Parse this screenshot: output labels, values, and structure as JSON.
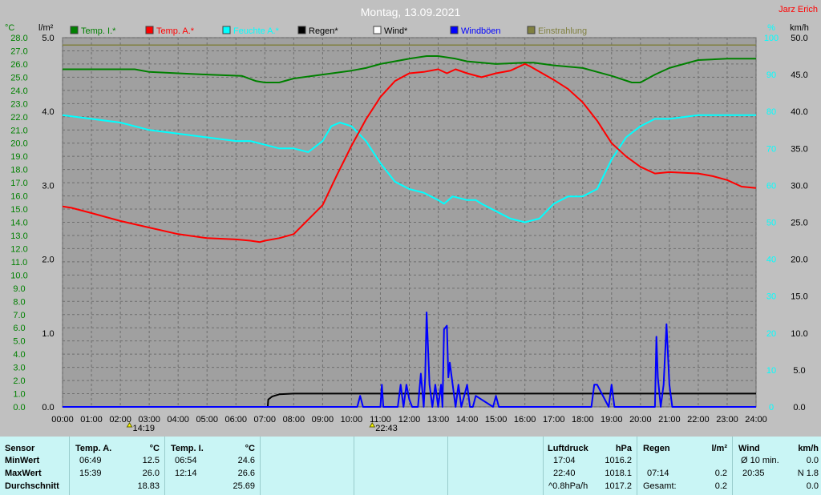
{
  "header": {
    "title": "Montag, 13.09.2021",
    "author": "Jarz Erich",
    "unit_left_temp": "°C",
    "unit_left_rain": "l/m²",
    "unit_right_pct": "%",
    "unit_right_kmh": "km/h"
  },
  "legend": [
    {
      "label": "Temp. I.*",
      "color": "#008000"
    },
    {
      "label": "Temp. A.*",
      "color": "#ff0000"
    },
    {
      "label": "Feuchte A.*",
      "color": "#00ffff"
    },
    {
      "label": "Regen*",
      "color": "#000000"
    },
    {
      "label": "Wind*",
      "color": "#ffffff"
    },
    {
      "label": "Windböen",
      "color": "#0000ff"
    },
    {
      "label": "Einstrahlung",
      "color": "#808040"
    }
  ],
  "markers": {
    "sunrise": "14:19",
    "sunset": "22:43"
  },
  "chart_data": {
    "type": "line",
    "x_unit": "time of day",
    "x_ticks": [
      "00:00",
      "01:00",
      "02:00",
      "03:00",
      "04:00",
      "05:00",
      "06:00",
      "07:00",
      "08:00",
      "09:00",
      "10:00",
      "11:00",
      "12:00",
      "13:00",
      "14:00",
      "15:00",
      "16:00",
      "17:00",
      "18:00",
      "19:00",
      "20:00",
      "21:00",
      "22:00",
      "23:00",
      "24:00"
    ],
    "temp_axis_ticks": [
      "28.0",
      "27.0",
      "26.0",
      "25.0",
      "24.0",
      "23.0",
      "22.0",
      "21.0",
      "20.0",
      "19.0",
      "18.0",
      "17.0",
      "16.0",
      "15.0",
      "14.0",
      "13.0",
      "12.0",
      "11.0",
      "10.0",
      "9.0",
      "8.0",
      "7.0",
      "6.0",
      "5.0",
      "4.0",
      "3.0",
      "2.0",
      "1.0",
      "0.0"
    ],
    "rain_axis_ticks": [
      "5.0",
      "4.0",
      "3.0",
      "2.0",
      "1.0",
      "0.0"
    ],
    "pct_axis_ticks": [
      "100",
      "90",
      "80",
      "70",
      "60",
      "50",
      "40",
      "30",
      "20",
      "10",
      "0"
    ],
    "kmh_axis_ticks": [
      "50.0",
      "45.0",
      "40.0",
      "35.0",
      "30.0",
      "25.0",
      "20.0",
      "15.0",
      "10.0",
      "5.0",
      "0.0"
    ],
    "ylim_temp": [
      0,
      28
    ],
    "ylim_rain": [
      0,
      5
    ],
    "ylim_pct": [
      0,
      100
    ],
    "ylim_kmh": [
      0,
      50
    ],
    "series": [
      {
        "name": "Temp. I.*",
        "axis": "temp",
        "color": "#008000",
        "x": [
          0,
          1,
          2,
          2.5,
          3,
          4,
          5,
          6.2,
          6.7,
          7,
          7.5,
          8,
          9,
          10,
          10.5,
          11,
          12,
          12.6,
          13,
          13.6,
          14,
          15,
          16,
          16.3,
          17,
          18,
          18.5,
          19,
          19.7,
          20,
          20.5,
          21,
          21.5,
          22,
          23,
          24
        ],
        "y": [
          25.6,
          25.6,
          25.6,
          25.6,
          25.4,
          25.3,
          25.2,
          25.1,
          24.7,
          24.6,
          24.6,
          24.9,
          25.2,
          25.5,
          25.7,
          26.0,
          26.4,
          26.6,
          26.6,
          26.4,
          26.2,
          26.0,
          26.1,
          26.1,
          25.9,
          25.7,
          25.4,
          25.1,
          24.6,
          24.6,
          25.2,
          25.7,
          26.0,
          26.3,
          26.4,
          26.4
        ]
      },
      {
        "name": "Temp. A.*",
        "axis": "temp",
        "color": "#ff0000",
        "x": [
          0,
          0.3,
          1,
          2,
          3,
          4,
          5,
          6,
          6.5,
          6.83,
          7,
          7.5,
          8,
          8.5,
          9,
          9.5,
          10,
          10.5,
          11,
          11.5,
          12,
          12.5,
          13,
          13.3,
          13.6,
          14,
          14.5,
          15,
          15.5,
          16,
          16.2,
          17,
          17.5,
          18,
          18.5,
          19,
          19.5,
          20,
          20.5,
          21,
          22,
          22.5,
          23,
          23.5,
          24
        ],
        "y": [
          15.2,
          15.1,
          14.7,
          14.1,
          13.6,
          13.1,
          12.8,
          12.7,
          12.6,
          12.5,
          12.6,
          12.8,
          13.1,
          14.2,
          15.3,
          17.6,
          19.8,
          21.8,
          23.5,
          24.7,
          25.3,
          25.4,
          25.6,
          25.3,
          25.6,
          25.3,
          25.0,
          25.3,
          25.5,
          26.0,
          25.8,
          24.8,
          24.1,
          23.1,
          21.7,
          20.0,
          19.0,
          18.2,
          17.7,
          17.8,
          17.7,
          17.5,
          17.2,
          16.7,
          16.6
        ]
      },
      {
        "name": "Feuchte A.*",
        "axis": "pct",
        "color": "#00ffff",
        "x": [
          0,
          1,
          2,
          3,
          4,
          5,
          6,
          6.5,
          7,
          7.5,
          8,
          8.5,
          9,
          9.3,
          9.6,
          10,
          10.5,
          11,
          11.5,
          12,
          12.5,
          13,
          13.2,
          13.5,
          14,
          14.3,
          14.5,
          15,
          15.5,
          16,
          16.5,
          17,
          17.5,
          18,
          18.5,
          19,
          19.5,
          20,
          20.5,
          21,
          22,
          23,
          24
        ],
        "y": [
          79,
          78,
          77,
          75,
          74,
          73,
          72,
          72,
          71,
          70,
          70,
          69,
          72,
          76,
          77,
          76,
          72,
          66,
          61,
          59,
          58,
          56,
          55,
          57,
          56,
          56,
          55,
          53,
          51,
          50,
          51,
          55,
          57,
          57,
          59,
          67,
          73,
          76,
          78,
          78,
          79,
          79,
          79
        ]
      },
      {
        "name": "Regen*",
        "axis": "rain",
        "color": "#000000",
        "x": [
          0,
          7.1,
          7.12,
          7.25,
          7.5,
          8,
          24
        ],
        "y": [
          0,
          0,
          0.1,
          0.14,
          0.17,
          0.18,
          0.18
        ]
      },
      {
        "name": "Windböen",
        "axis": "kmh",
        "color": "#0000ff",
        "x": [
          0,
          10.2,
          10.3,
          10.4,
          11,
          11.05,
          11.1,
          11.6,
          11.7,
          11.8,
          11.9,
          12,
          12.1,
          12.3,
          12.4,
          12.5,
          12.55,
          12.6,
          12.7,
          12.8,
          12.9,
          13,
          13.1,
          13.15,
          13.2,
          13.3,
          13.35,
          13.4,
          13.5,
          13.6,
          13.7,
          13.8,
          13.9,
          14,
          14.1,
          14.2,
          14.3,
          14.9,
          15,
          15.1,
          18.3,
          18.4,
          18.5,
          18.9,
          19,
          19.1,
          20.5,
          20.55,
          20.6,
          20.7,
          20.8,
          20.9,
          21,
          21.1,
          21.2,
          24
        ],
        "y": [
          0,
          0,
          1.5,
          0,
          0,
          3,
          0,
          0,
          3,
          0,
          3,
          1,
          0,
          0,
          4.5,
          0,
          4,
          12.8,
          3,
          0,
          3,
          0,
          3,
          0,
          10.5,
          11,
          4,
          6,
          3,
          0,
          3,
          0,
          1.5,
          3,
          0,
          0,
          1.5,
          0,
          1.5,
          0,
          0,
          3,
          3,
          0,
          3,
          0,
          0,
          9.5,
          4,
          0,
          3,
          11.2,
          3,
          0,
          0,
          0
        ]
      },
      {
        "name": "Einstrahlung",
        "axis": "pct",
        "color": "#808040",
        "level": 98
      }
    ]
  },
  "stats": {
    "sensor": {
      "header": "Sensor",
      "rows": [
        "MinWert",
        "MaxWert",
        "Durchschnitt"
      ]
    },
    "temp_a": {
      "header": "Temp. A.",
      "unit": "°C",
      "times": [
        "06:49",
        "15:39",
        ""
      ],
      "values": [
        "12.5",
        "26.0",
        "18.83"
      ]
    },
    "temp_i": {
      "header": "Temp. I.",
      "unit": "°C",
      "times": [
        "06:54",
        "12:14",
        ""
      ],
      "values": [
        "24.6",
        "26.6",
        "25.69"
      ]
    },
    "pressure": {
      "header": "Luftdruck",
      "unit": "hPa",
      "times": [
        "17:04",
        "22:40",
        "^0.8hPa/h"
      ],
      "values": [
        "1016.2",
        "1018.1",
        "1017.2"
      ]
    },
    "rain": {
      "header": "Regen",
      "unit": "l/m²",
      "times": [
        "",
        "07:14",
        "Gesamt:"
      ],
      "values": [
        "",
        "0.2",
        "0.2"
      ]
    },
    "wind": {
      "header": "Wind",
      "unit": "km/h",
      "times": [
        "Ø 10 min.",
        "20:35",
        ""
      ],
      "values": [
        "0.0",
        "N 1.8",
        "0.0"
      ]
    }
  }
}
